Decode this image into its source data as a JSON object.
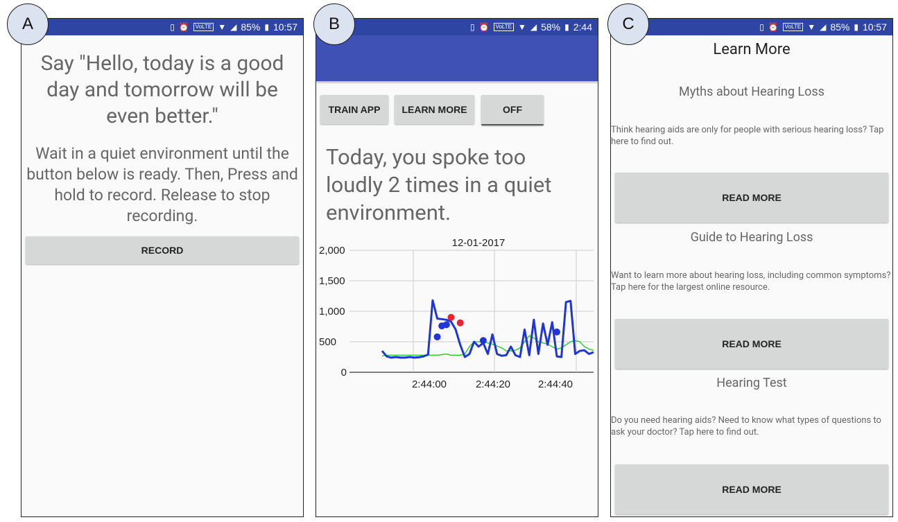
{
  "labels": {
    "a": "A",
    "b": "B",
    "c": "C"
  },
  "screen_a": {
    "status": {
      "battery": "85%",
      "time": "10:57",
      "volte": "VoLTE"
    },
    "prompt": "Say \"Hello, today is a good day and tomorrow will be even better.\"",
    "instructions": "Wait in a quiet environment until the button below is ready. Then, Press and hold to record. Release to stop recording.",
    "record_button": "RECORD"
  },
  "screen_b": {
    "status": {
      "battery": "58%",
      "time": "2:44",
      "volte": "VoLTE"
    },
    "buttons": {
      "train": "TRAIN APP",
      "learn": "LEARN MORE",
      "toggle": "OFF"
    },
    "message": "Today, you spoke too loudly 2 times in a quiet environment.",
    "chart_data": {
      "type": "line",
      "title": "12-01-2017",
      "y_ticks": [
        "2,000",
        "1,500",
        "1,000",
        "500",
        "0"
      ],
      "ylim": [
        0,
        2000
      ],
      "x_ticks": [
        "2:44:00",
        "2:44:20",
        "2:44:40"
      ],
      "grid": true,
      "series": [
        {
          "color": "#1f35d6",
          "values": [
            350,
            260,
            240,
            250,
            240,
            240,
            250,
            240,
            245,
            260,
            290,
            1180,
            880,
            870,
            860,
            830,
            700,
            450,
            250,
            300,
            500,
            420,
            480,
            300,
            620,
            300,
            270,
            280,
            420,
            280,
            250,
            700,
            280,
            860,
            300,
            800,
            450,
            820,
            260,
            250,
            1150,
            1170,
            300,
            350,
            360,
            300,
            330
          ]
        },
        {
          "color": "#33cc33",
          "values": [
            270,
            280,
            280,
            280,
            280,
            280,
            280,
            280,
            280,
            280,
            280,
            280,
            280,
            290,
            300,
            280,
            280,
            280,
            300,
            420,
            500,
            500,
            500,
            480,
            460,
            430,
            400,
            350,
            350,
            360,
            400,
            500,
            600,
            560,
            500,
            480,
            460,
            420,
            380,
            400,
            450,
            500,
            520,
            500,
            420,
            380,
            360
          ]
        }
      ],
      "markers": [
        {
          "color": "#1f35d6",
          "index": 12,
          "value": 580
        },
        {
          "color": "#1f35d6",
          "index": 13,
          "value": 760
        },
        {
          "color": "#1f35d6",
          "index": 14,
          "value": 780
        },
        {
          "color": "#e8252d",
          "index": 15,
          "value": 900
        },
        {
          "color": "#e8252d",
          "index": 17,
          "value": 810
        },
        {
          "color": "#1f35d6",
          "index": 22,
          "value": 520
        },
        {
          "color": "#1f35d6",
          "index": 38,
          "value": 660
        }
      ]
    }
  },
  "screen_c": {
    "status": {
      "battery": "85%",
      "time": "10:57",
      "volte": "VoLTE"
    },
    "title": "Learn More",
    "sections": [
      {
        "heading": "Myths about Hearing Loss",
        "body": "Think hearing aids are only for people with serious hearing loss? Tap here to find out.",
        "button": "READ MORE"
      },
      {
        "heading": "Guide to Hearing Loss",
        "body": "Want to learn more about hearing loss, including common symptoms? Tap here for the largest online resource.",
        "button": "READ MORE"
      },
      {
        "heading": "Hearing Test",
        "body": "Do you need hearing aids? Need to know what types of questions to ask your doctor? Tap here to find out.",
        "button": "READ MORE"
      }
    ]
  }
}
